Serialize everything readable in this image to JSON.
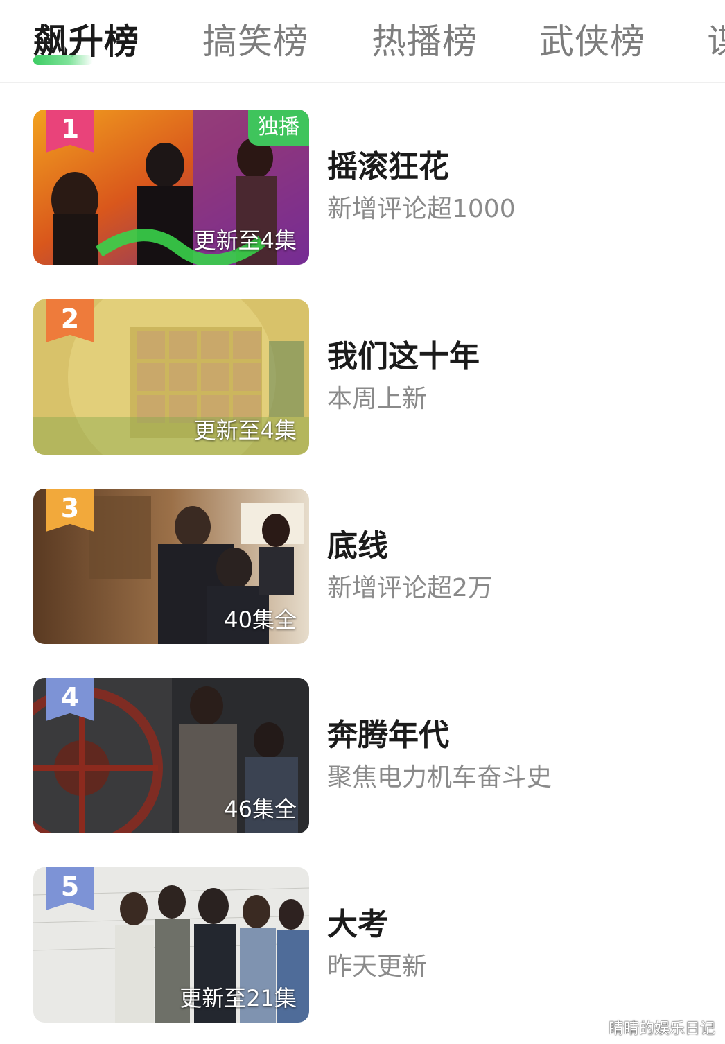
{
  "tabs": [
    {
      "label": "飙升榜"
    },
    {
      "label": "搞笑榜"
    },
    {
      "label": "热播榜"
    },
    {
      "label": "武侠榜"
    },
    {
      "label": "谍"
    }
  ],
  "colors": {
    "accent_green": "#3dcc63",
    "rank1": "#e9437a",
    "rank2": "#ee7b3b",
    "rank3": "#f2a93b",
    "rank4": "#7d93d6",
    "rank5": "#7d93d6"
  },
  "items": [
    {
      "rank": "1",
      "title": "摇滚狂花",
      "subtitle": "新增评论超1000",
      "episodes": "更新至4集",
      "badge": "独播"
    },
    {
      "rank": "2",
      "title": "我们这十年",
      "subtitle": "本周上新",
      "episodes": "更新至4集"
    },
    {
      "rank": "3",
      "title": "底线",
      "subtitle": "新增评论超2万",
      "episodes": "40集全"
    },
    {
      "rank": "4",
      "title": "奔腾年代",
      "subtitle": "聚焦电力机车奋斗史",
      "episodes": "46集全"
    },
    {
      "rank": "5",
      "title": "大考",
      "subtitle": "昨天更新",
      "episodes": "更新至21集"
    }
  ],
  "watermark": "睛睛的娱乐日记"
}
